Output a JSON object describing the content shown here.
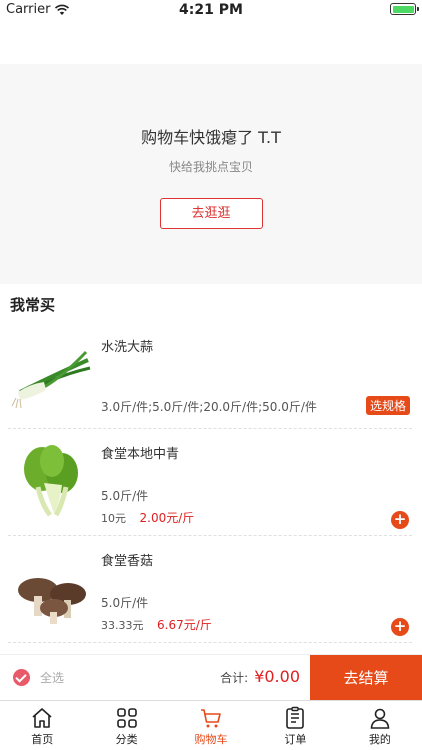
{
  "status_bar": {
    "carrier": "Carrier",
    "time": "4:21 PM"
  },
  "empty_cart": {
    "title": "购物车快饿瘪了 T.T",
    "subtitle": "快给我挑点宝贝",
    "button": "去逛逛"
  },
  "section": {
    "title": "我常买"
  },
  "products": [
    {
      "name": "水洗大蒜",
      "spec": "3.0斤/件;5.0斤/件;20.0斤/件;50.0斤/件",
      "action": "选规格",
      "image_icon": "scallion-image"
    },
    {
      "name": "食堂本地中青",
      "spec": "5.0斤/件",
      "original_price": "10元",
      "sale_price": "2.00元/斤",
      "image_icon": "bok-choy-image"
    },
    {
      "name": "食堂香菇",
      "spec": "5.0斤/件",
      "original_price": "33.33元",
      "sale_price": "6.67元/斤",
      "image_icon": "mushroom-image"
    }
  ],
  "cart_bar": {
    "select_all": "全选",
    "total_label": "合计:",
    "total_value": "¥0.00",
    "checkout": "去结算"
  },
  "tabs": [
    {
      "label": "首页",
      "icon": "home-icon"
    },
    {
      "label": "分类",
      "icon": "category-icon"
    },
    {
      "label": "购物车",
      "icon": "cart-icon",
      "active": true
    },
    {
      "label": "订单",
      "icon": "order-icon"
    },
    {
      "label": "我的",
      "icon": "user-icon"
    }
  ],
  "colors": {
    "accent": "#e64a19",
    "price": "#e02020",
    "banner_bg": "#f7f7f7"
  }
}
